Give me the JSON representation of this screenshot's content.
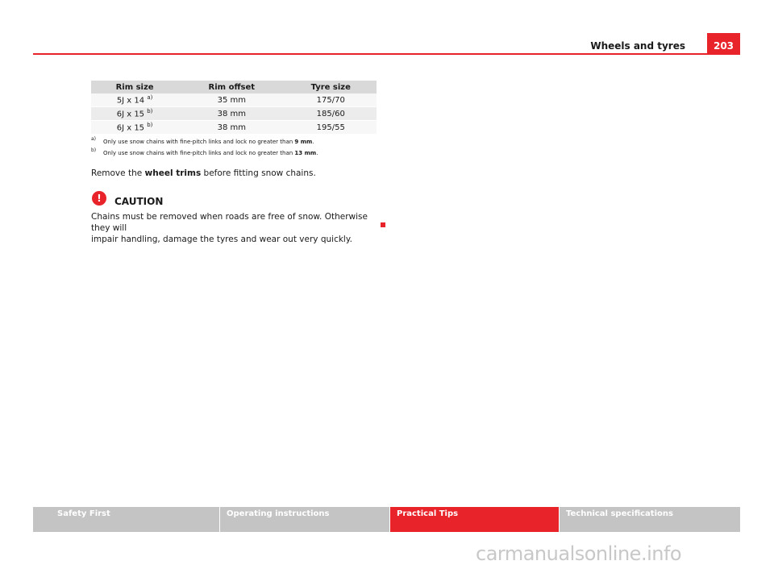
{
  "header": {
    "title": "Wheels and tyres",
    "page_number": "203"
  },
  "table": {
    "columns": [
      "Rim size",
      "Rim offset",
      "Tyre size"
    ],
    "rows": [
      {
        "rim_size": "5J x 14",
        "note": "a)",
        "rim_offset": "35 mm",
        "tyre_size": "175/70"
      },
      {
        "rim_size": "6J x 15",
        "note": "b)",
        "rim_offset": "38 mm",
        "tyre_size": "185/60"
      },
      {
        "rim_size": "6J x 15",
        "note": "b)",
        "rim_offset": "38 mm",
        "tyre_size": "195/55"
      }
    ]
  },
  "footnotes": [
    {
      "mark": "a)",
      "text": "Only use snow chains with fine-pitch links and lock no greater than ",
      "value": "9 mm",
      "end": "."
    },
    {
      "mark": "b)",
      "text": "Only use snow chains with fine-pitch links and lock no greater than ",
      "value": "13 mm",
      "end": "."
    }
  ],
  "body": {
    "prefix": "Remove the ",
    "bold": "wheel trims",
    "suffix": " before fitting snow chains."
  },
  "caution": {
    "icon": "!",
    "title": "CAUTION",
    "line1": "Chains must be removed when roads are free of snow. Otherwise they will",
    "line2": "impair handling, damage the tyres and wear out very quickly."
  },
  "footer_tabs": [
    {
      "label": "Safety First",
      "active": false
    },
    {
      "label": "Operating instructions",
      "active": false
    },
    {
      "label": "Practical Tips",
      "active": true
    },
    {
      "label": "Technical specifications",
      "active": false
    }
  ],
  "watermark": "carmanualsonline.info",
  "colors": {
    "accent": "#e8232a",
    "tab_inactive": "#c4c4c4"
  }
}
